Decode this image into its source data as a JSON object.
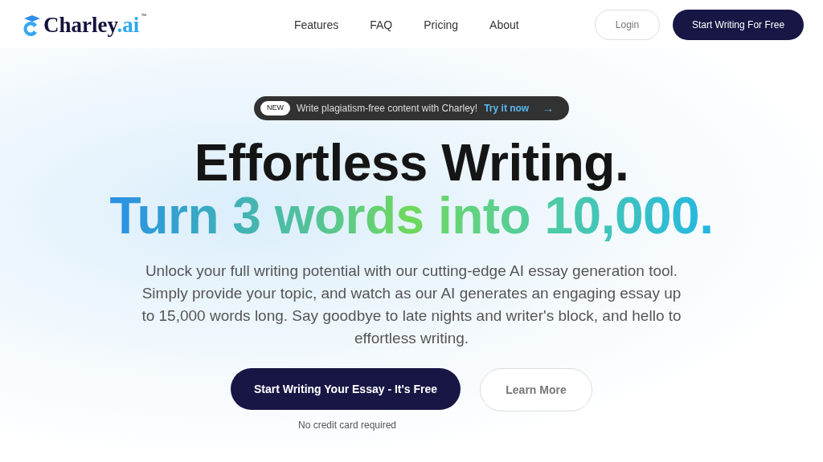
{
  "logo": {
    "name": "Charley",
    "suffix": ".ai",
    "trademark": "™"
  },
  "nav": [
    "Features",
    "FAQ",
    "Pricing",
    "About"
  ],
  "header_buttons": {
    "login": "Login",
    "cta": "Start Writing For Free"
  },
  "announcement": {
    "badge": "NEW",
    "text": "Write plagiatism-free content with Charley!",
    "link": "Try it now",
    "arrow": "→"
  },
  "hero": {
    "title": "Effortless Writing.",
    "subtitle": "Turn 3 words into 10,000.",
    "description": "Unlock your full writing potential with our cutting-edge AI essay generation tool. Simply provide your topic, and watch as our AI generates an engaging essay up to 15,000 words long. Say goodbye to late nights and writer's block, and hello to effortless writing.",
    "primary_button": "Start Writing Your Essay - It's Free",
    "secondary_button": "Learn More",
    "note": "No credit card required"
  }
}
